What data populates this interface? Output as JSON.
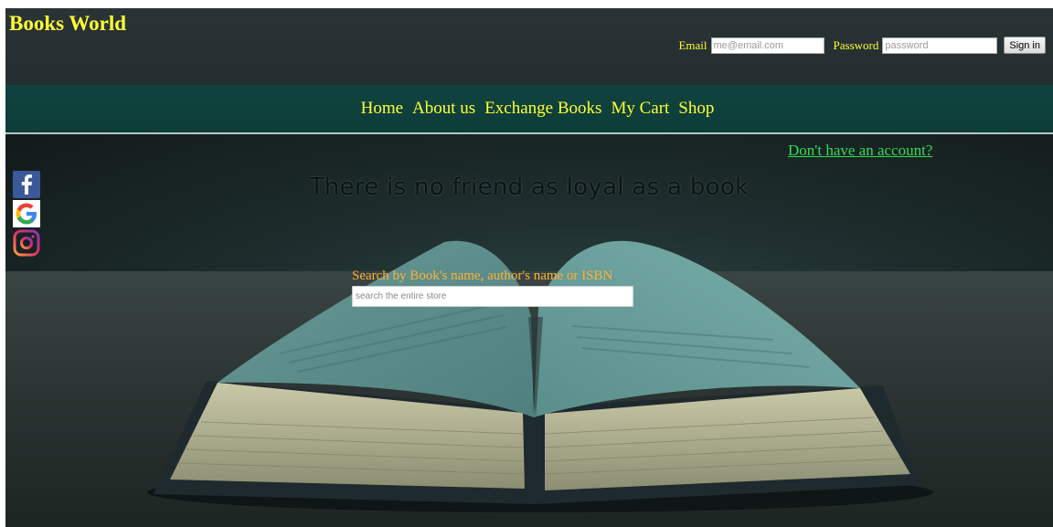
{
  "header": {
    "brand": "Books World",
    "email_label": "Email",
    "email_placeholder": "me@email.com",
    "password_label": "Password",
    "password_placeholder": "password",
    "signin_label": "Sign in"
  },
  "nav": {
    "items": [
      {
        "label": "Home"
      },
      {
        "label": "About us"
      },
      {
        "label": "Exchange Books"
      },
      {
        "label": "My Cart"
      },
      {
        "label": "Shop"
      }
    ]
  },
  "hero": {
    "account_link": "Don't have an account?",
    "tagline": "There is no friend as loyal as a book",
    "search_label": "Search by Book's name, author's name or ISBN",
    "search_placeholder": "search the entire store"
  },
  "social": {
    "icons": [
      "facebook-icon",
      "google-icon",
      "instagram-icon"
    ]
  },
  "colors": {
    "brand": "#ffff33",
    "nav_bg": "#0f433f",
    "account_link": "#33dd55",
    "search_label": "#ffb133"
  }
}
